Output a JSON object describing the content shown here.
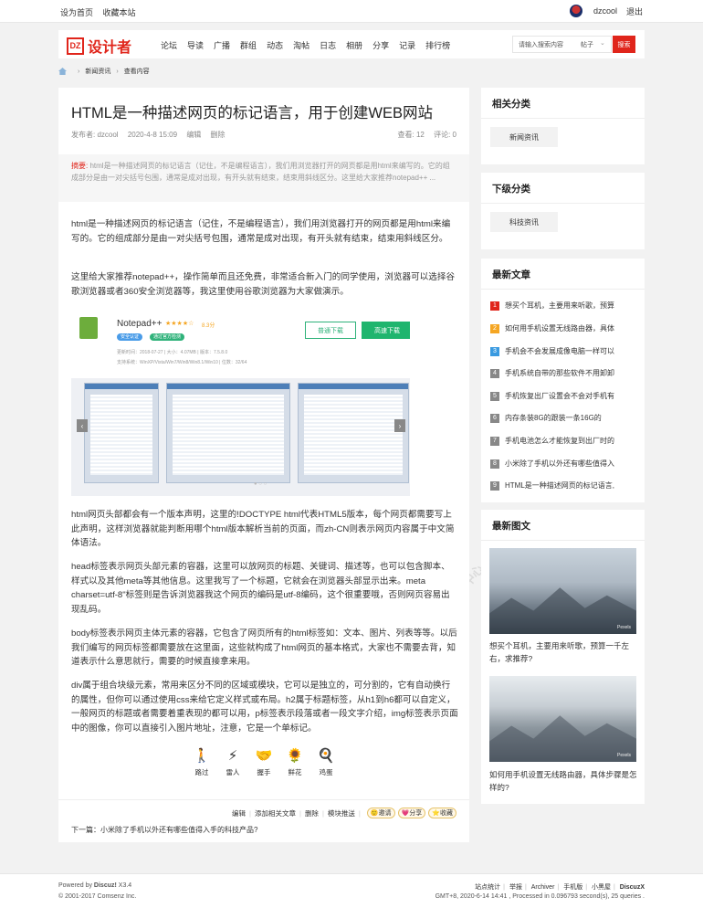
{
  "topbar": {
    "set_home": "设为首页",
    "bookmark": "收藏本站",
    "username": "dzcool",
    "logout": "退出"
  },
  "header": {
    "logo_mark": "DZ",
    "logo_text": "设计者",
    "nav": [
      "论坛",
      "导读",
      "广播",
      "群组",
      "动态",
      "淘帖",
      "日志",
      "相册",
      "分享",
      "记录",
      "排行榜"
    ],
    "search_placeholder": "请输入搜索内容",
    "search_type": "帖子",
    "search_button": "搜索"
  },
  "breadcrumb": {
    "items": [
      "新闻资讯",
      "查看内容"
    ]
  },
  "article": {
    "title": "HTML是一种描述网页的标记语言，用于创建WEB网站",
    "author": "发布者: dzcool",
    "date": "2020-4-8 15:09",
    "edit": "编辑",
    "delete": "删除",
    "views": "查看: 12",
    "comments": "评论: 0",
    "summary_label": "摘要:",
    "summary": "html是一种描述网页的标记语言（记住，不是编程语言），我们用浏览器打开的网页都是用html来编写的。它的组成部分是由一对尖括号包围，通常是成对出现，有开头就有结束，结束用斜线区分。这里给大家推荐notepad++ ...",
    "p1": "html是一种描述网页的标记语言（记住，不是编程语言），我们用浏览器打开的网页都是用html来编写的。它的组成部分是由一对尖括号包围，通常是成对出现，有开头就有结束，结束用斜线区分。",
    "p2": "这里给大家推荐notepad++，操作简单而且还免费，非常适合新入门的同学使用，浏览器可以选择谷歌浏览器或者360安全浏览器等，我这里使用谷歌浏览器为大家做演示。",
    "p3": "html网页头部都会有一个版本声明，这里的!DOCTYPE html代表HTML5版本，每个网页都需要写上此声明，这样浏览器就能判断用哪个html版本解析当前的页面，而zh-CN则表示网页内容属于中文简体语法。",
    "p4": "head标签表示网页头部元素的容器，这里可以放网页的标题、关键词、描述等，也可以包含脚本、样式以及其他meta等其他信息。这里我写了一个标题，它就会在浏览器头部显示出来。meta charset=utf-8\"标签则是告诉浏览器我这个网页的编码是utf-8编码，这个很重要哦，否则网页容易出现乱码。",
    "p5": "body标签表示网页主体元素的容器，它包含了网页所有的html标签如：文本、图片、列表等等。以后我们编写的网页标签都需要放在这里面，这些就构成了html网页的基本格式，大家也不需要去背，知道表示什么意思就行，需要的时候直接拿来用。",
    "p6": "div属于组合块级元素，常用来区分不同的区域或模块，它可以是独立的，可分割的，它有自动换行的属性，但你可以通过使用css来给它定义样式或布局。h2属于标题标签，从h1到h6都可以自定义，一般网页的标题或者需要着重表现的都可以用，p标签表示段落或者一段文字介绍，img标签表示页面中的图像，你可以直接引入图片地址，注意，它是一个单标记。",
    "screenshot": {
      "app": "Notepad++",
      "stars": "★★★★☆",
      "score": "8.3分",
      "tag1": "安全认证",
      "tag2": "通过官方检测",
      "info1": "更新时间：2018-07-27 | 大小：4.07MB | 版本：7.5.8.0",
      "info2": "支持系统：WinXP/Vista/Win7/Win8/Win8.1/Win10 | 位数：32/64",
      "btn_normal": "普通下载",
      "btn_fast": "高速下载",
      "prev": "‹",
      "next": "›",
      "dots": "● ○ ○"
    },
    "reactions": [
      {
        "icon": "🚶",
        "label": "路过"
      },
      {
        "icon": "⚡",
        "label": "雷人"
      },
      {
        "icon": "🤝",
        "label": "握手"
      },
      {
        "icon": "🌻",
        "label": "鲜花"
      },
      {
        "icon": "🍳",
        "label": "鸡蛋"
      }
    ],
    "actions": [
      "编辑",
      "添加相关文章",
      "删除",
      "模块推送"
    ],
    "invite": "邀请",
    "share": "分享",
    "favorite": "收藏",
    "next": "下一篇：小米除了手机以外还有哪些值得入手的科技产品?"
  },
  "sidebar": {
    "related_title": "相关分类",
    "related_tag": "新闻资讯",
    "sub_title": "下级分类",
    "sub_tag": "科技资讯",
    "latest_title": "最新文章",
    "latest": [
      {
        "n": "1",
        "t": "想买个耳机，主要用来听歌，预算",
        "c": "#e0251b"
      },
      {
        "n": "2",
        "t": "如何用手机设置无线路由器，具体",
        "c": "#f5a623"
      },
      {
        "n": "3",
        "t": "手机会不会发展成像电脑一样可以",
        "c": "#3a9ae0"
      },
      {
        "n": "4",
        "t": "手机系统自带的那些软件不用卸卸",
        "c": "#888888"
      },
      {
        "n": "5",
        "t": "手机恢复出厂设置会不会对手机有",
        "c": "#888888"
      },
      {
        "n": "6",
        "t": "内存条装8G的跟装一条16G的",
        "c": "#888888"
      },
      {
        "n": "7",
        "t": "手机电池怎么才能恢复到出厂时的",
        "c": "#888888"
      },
      {
        "n": "8",
        "t": "小米除了手机以外还有哪些值得入",
        "c": "#888888"
      },
      {
        "n": "9",
        "t": "HTML是一种描述网页的标记语言,",
        "c": "#888888"
      }
    ],
    "pics_title": "最新图文",
    "pic1_caption": "想买个耳机，主要用来听歌，预算一千左右，求推荐?",
    "pic2_caption": "如何用手机设置无线路由器，具体步骤是怎样的?",
    "pic_mark": "Pexels"
  },
  "footer": {
    "powered": "Powered by",
    "brand": "Discuz!",
    "version": "X3.4",
    "copyright": "© 2001-2017 Comsenz Inc.",
    "links": [
      "站点统计",
      "举报",
      "Archiver",
      "手机版",
      "小黑屋"
    ],
    "discuzx": "DiscuzX",
    "stats": "GMT+8, 2020-6-14 14:41 , Processed in 0.096793 second(s), 25 queries ."
  },
  "watermark": "DISCUZ!应用中心"
}
